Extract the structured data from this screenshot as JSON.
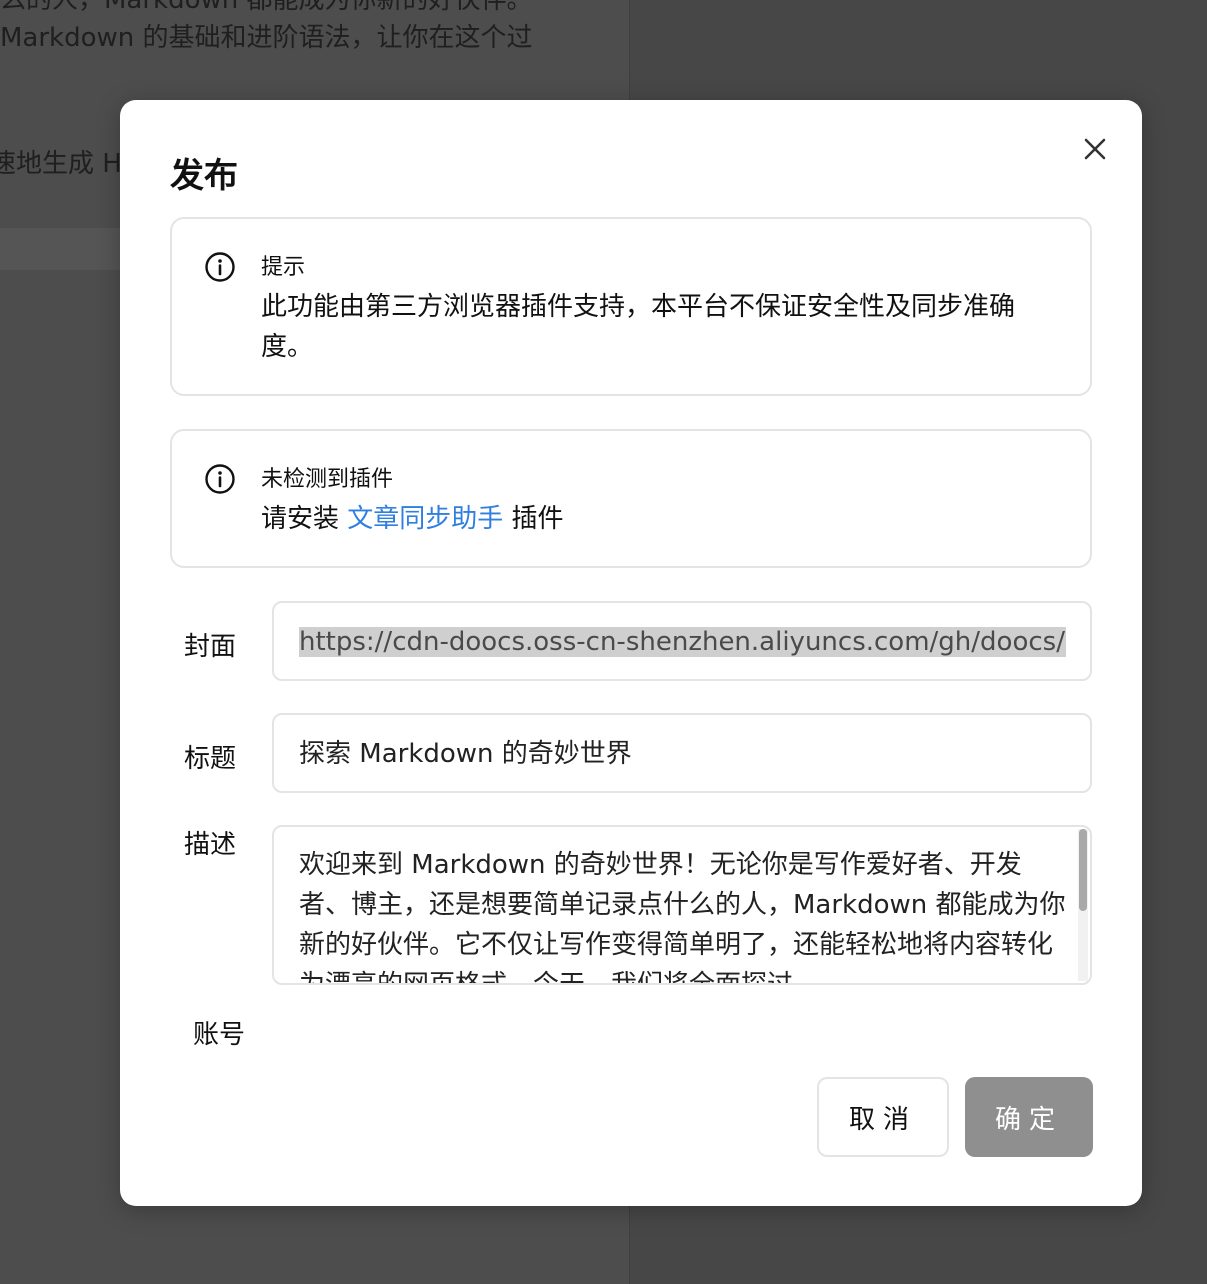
{
  "background": {
    "line1": "么的人，Markdown 都能成为你新的好伙伴。",
    "line2": "Markdown 的基础和进阶语法，让你在这个过",
    "line3": "速地生成 H"
  },
  "dialog": {
    "title": "发布",
    "close_icon": "close-icon"
  },
  "alerts": [
    {
      "icon": "info-icon",
      "title": "提示",
      "body": "此功能由第三方浏览器插件支持，本平台不保证安全性及同步准确度。"
    },
    {
      "icon": "info-icon",
      "title": "未检测到插件",
      "body_prefix": "请安装 ",
      "link": "文章同步助手",
      "body_suffix": " 插件"
    }
  ],
  "form": {
    "cover_label": "封面",
    "cover_value": "https://cdn-doocs.oss-cn-shenzhen.aliyuncs.com/gh/doocs/md",
    "title_label": "标题",
    "title_value": "探索 Markdown 的奇妙世界",
    "desc_label": "描述",
    "desc_value": "欢迎来到 Markdown 的奇妙世界！无论你是写作爱好者、开发者、博主，还是想要简单记录点什么的人，Markdown 都能成为你新的好伙伴。它不仅让写作变得简单明了，还能轻松地将内容转化为漂亮的网页格式。今天，我们将全面探过",
    "account_label": "账号"
  },
  "buttons": {
    "cancel": "取消",
    "confirm": "确定"
  },
  "colors": {
    "link": "#2f7fe0",
    "confirm_bg": "#8f8f8f",
    "overlay": "#4b4b4b"
  }
}
